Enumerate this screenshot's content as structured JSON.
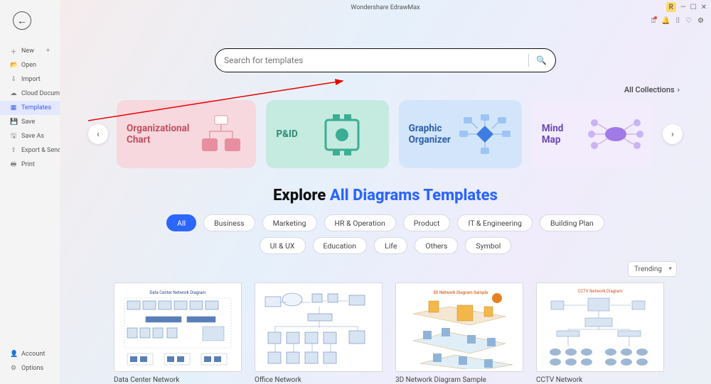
{
  "app_title": "Wondershare EdrawMax",
  "user_badge": "R",
  "sidebar": {
    "items": [
      {
        "icon": "＋",
        "label": "New"
      },
      {
        "icon": "📂",
        "label": "Open"
      },
      {
        "icon": "⇩",
        "label": "Import"
      },
      {
        "icon": "☁",
        "label": "Cloud Documents"
      },
      {
        "icon": "▦",
        "label": "Templates"
      },
      {
        "icon": "💾",
        "label": "Save"
      },
      {
        "icon": "🖫",
        "label": "Save As"
      },
      {
        "icon": "⇧",
        "label": "Export & Send"
      },
      {
        "icon": "🖶",
        "label": "Print"
      }
    ],
    "active_index": 4,
    "bottom": [
      {
        "icon": "👤",
        "label": "Account"
      },
      {
        "icon": "⚙",
        "label": "Options"
      }
    ]
  },
  "toolbar_icons": [
    "help",
    "bell",
    "apps",
    "filter",
    "gear"
  ],
  "search": {
    "placeholder": "Search for templates"
  },
  "all_collections_label": "All Collections",
  "carousel": {
    "cards": [
      {
        "title": "Organizational\nChart",
        "theme": "pink"
      },
      {
        "title": "P&ID",
        "theme": "teal"
      },
      {
        "title": "Graphic\nOrganizer",
        "theme": "blue"
      },
      {
        "title": "Mind Map",
        "theme": "purple"
      }
    ]
  },
  "explore": {
    "prefix": "Explore ",
    "highlight": "All Diagrams Templates"
  },
  "filter_rows": [
    [
      "All",
      "Business",
      "Marketing",
      "HR & Operation",
      "Product",
      "IT & Engineering",
      "Building Plan"
    ],
    [
      "UI & UX",
      "Education",
      "Life",
      "Others",
      "Symbol"
    ]
  ],
  "filter_active": "All",
  "sort": {
    "value": "Trending"
  },
  "templates": [
    {
      "label": "Data Center Network"
    },
    {
      "label": "Office Network"
    },
    {
      "label": "3D Network Diagram Sample"
    },
    {
      "label": "CCTV Network"
    }
  ]
}
